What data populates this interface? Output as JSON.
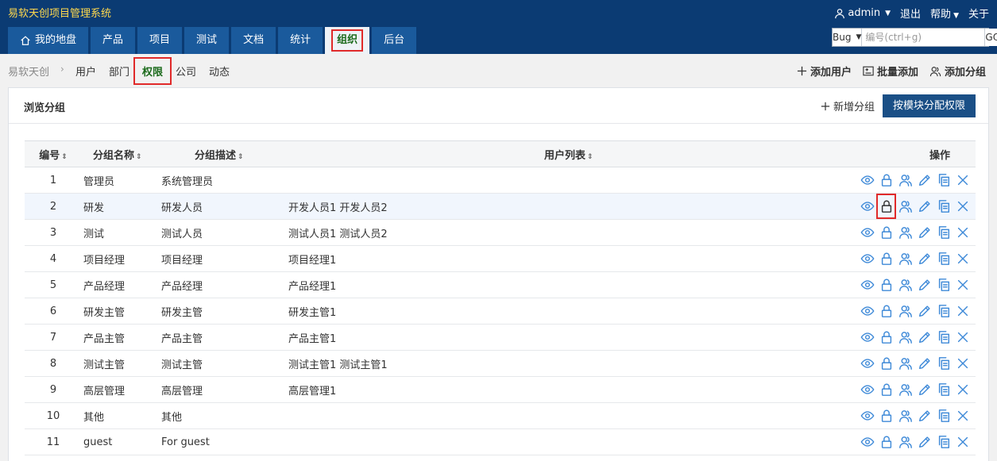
{
  "app": {
    "title": "易软天创项目管理系统"
  },
  "user_menu": {
    "user": "admin",
    "logout": "退出",
    "help": "帮助",
    "about": "关于"
  },
  "nav": {
    "tabs": [
      {
        "label": "我的地盘"
      },
      {
        "label": "产品"
      },
      {
        "label": "项目"
      },
      {
        "label": "测试"
      },
      {
        "label": "文档"
      },
      {
        "label": "统计"
      },
      {
        "label": "组织"
      },
      {
        "label": "后台"
      }
    ],
    "active": "组织"
  },
  "search": {
    "type": "Bug",
    "placeholder": "编号(ctrl+g)",
    "go": "GO!"
  },
  "subnav": {
    "root": "易软天创",
    "items": [
      {
        "label": "用户"
      },
      {
        "label": "部门"
      },
      {
        "label": "权限"
      },
      {
        "label": "公司"
      },
      {
        "label": "动态"
      }
    ],
    "active": "权限",
    "actions": {
      "add_user": "添加用户",
      "batch_add": "批量添加",
      "add_group": "添加分组"
    }
  },
  "panel": {
    "title": "浏览分组",
    "new_group": "新增分组",
    "assign_by_module": "按模块分配权限"
  },
  "table": {
    "headers": {
      "id": "编号",
      "name": "分组名称",
      "desc": "分组描述",
      "users": "用户列表",
      "ops": "操作"
    },
    "rows": [
      {
        "id": "1",
        "name": "管理员",
        "desc": "系统管理员",
        "users": ""
      },
      {
        "id": "2",
        "name": "研发",
        "desc": "研发人员",
        "users": "开发人员1 开发人员2"
      },
      {
        "id": "3",
        "name": "测试",
        "desc": "测试人员",
        "users": "测试人员1 测试人员2"
      },
      {
        "id": "4",
        "name": "项目经理",
        "desc": "项目经理",
        "users": "项目经理1"
      },
      {
        "id": "5",
        "name": "产品经理",
        "desc": "产品经理",
        "users": "产品经理1"
      },
      {
        "id": "6",
        "name": "研发主管",
        "desc": "研发主管",
        "users": "研发主管1"
      },
      {
        "id": "7",
        "name": "产品主管",
        "desc": "产品主管",
        "users": "产品主管1"
      },
      {
        "id": "8",
        "name": "测试主管",
        "desc": "测试主管",
        "users": "测试主管1 测试主管1"
      },
      {
        "id": "9",
        "name": "高层管理",
        "desc": "高层管理",
        "users": "高层管理1"
      },
      {
        "id": "10",
        "name": "其他",
        "desc": "其他",
        "users": ""
      },
      {
        "id": "11",
        "name": "guest",
        "desc": "For guest",
        "users": ""
      }
    ],
    "row_ops": [
      "view-icon",
      "lock-icon",
      "users-icon",
      "edit-icon",
      "copy-icon",
      "delete-icon"
    ]
  }
}
